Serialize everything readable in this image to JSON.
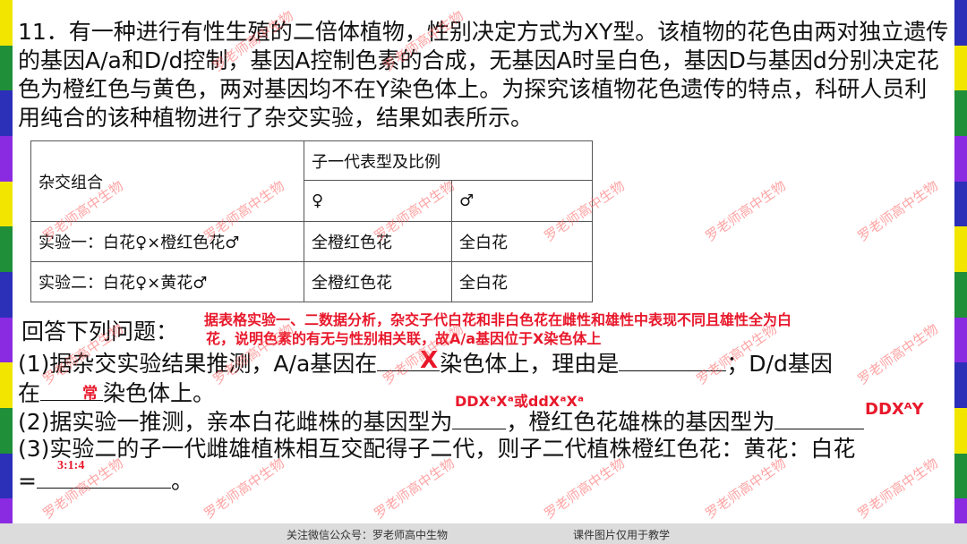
{
  "question": {
    "stem": "11．有一种进行有性生殖的二倍体植物，性别决定方式为XY型。该植物的花色由两对独立遗传的基因A/a和D/d控制，基因A控制色素的合成，无基因A时呈白色，基因D与基因d分别决定花色为橙红色与黄色，两对基因均不在Y染色体上。为探究该植物花色遗传的特点，科研人员利用纯合的该种植物进行了杂交实验，结果如表所示。"
  },
  "table": {
    "header_group": "杂交组合",
    "header_offspring": "子一代表型及比例",
    "header_female": "♀",
    "header_male": "♂",
    "rows": [
      {
        "cross": "实验一：白花♀×橙红色花♂",
        "female": "全橙红色花",
        "male": "全白花"
      },
      {
        "cross": "实验二：白花♀×黄花♂",
        "female": "全橙红色花",
        "male": "全白花"
      }
    ]
  },
  "qa": {
    "intro": "回答下列问题：",
    "q1_a": "(1)据杂交实验结果推测，A/a基因在",
    "q1_b": "染色体上，理由是",
    "q1_c": "；D/d基因",
    "q1_d": "在",
    "q1_e": "染色体上。",
    "q2_a": "(2)据实验一推测，亲本白花雌株的基因型为",
    "q2_b": "，橙红色花雄株的基因型为",
    "q3_a": "(3)实验二的子一代雌雄植株相互交配得子二代，则子二代植株橙红色花：黄花：白花",
    "q3_b": "=",
    "q3_c": "。"
  },
  "answers": {
    "reason_line1": "据表格实验一、二数据分析，杂交子代白花和非白色花在雌性和雄性中表现不同且雄性全为白",
    "reason_line2": "花，说明色素的有无与性别相关联，故A/a基因位于X染色体上",
    "a1": "X",
    "a2": "常",
    "a3": "DDXᵃXᵃ或ddXᵃXᵃ",
    "a4": "DDXᴬY",
    "a5": "3:1:4"
  },
  "footer": {
    "left": "关注微信公众号：罗老师高中生物",
    "right": "课件图片仅用于教学"
  },
  "watermark": "罗老师高中生物",
  "colors": {
    "answer": "#e8182b",
    "side_strip": [
      "#f2e600",
      "#1f8f3a",
      "#2c2fb8",
      "#8a2be2",
      "#f2e600",
      "#1f8f3a",
      "#2c2fb8",
      "#8a2be2",
      "#f2e600",
      "#1f8f3a",
      "#2c2fb8",
      "#8a2be2"
    ]
  }
}
